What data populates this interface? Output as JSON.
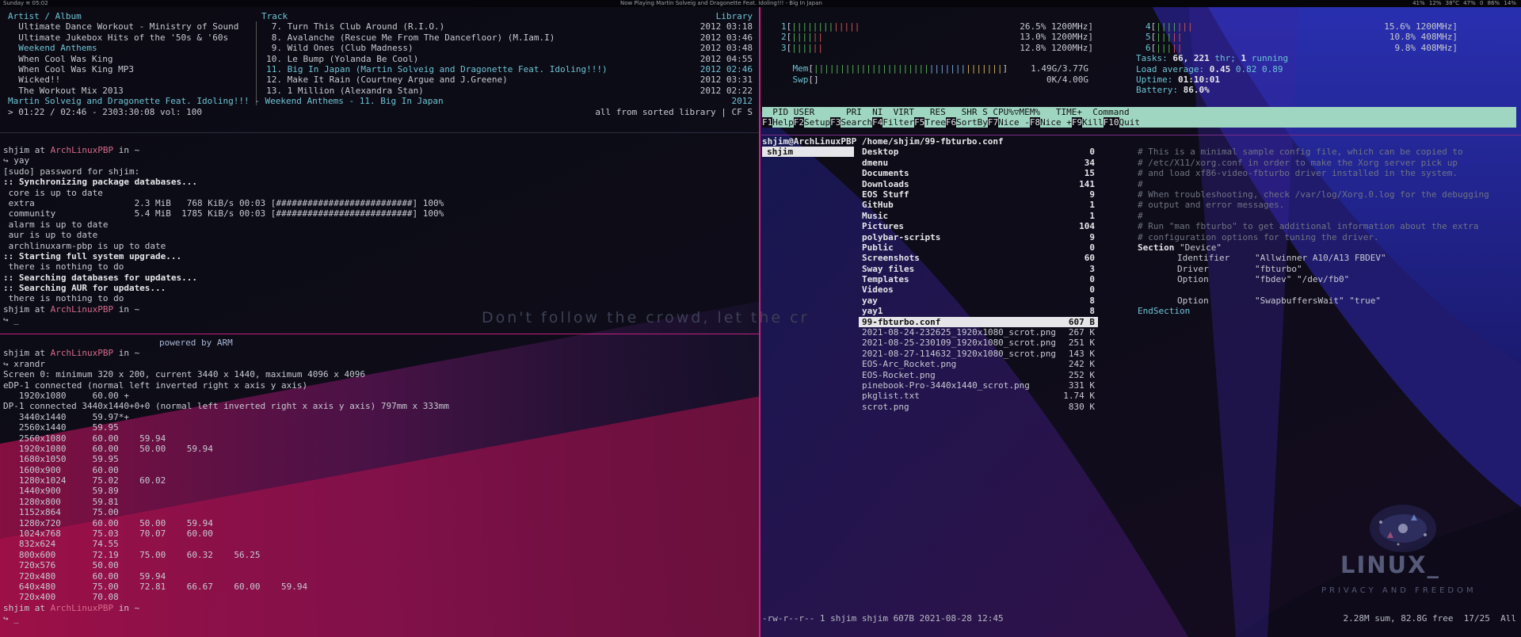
{
  "topbar": {
    "left": "Sunday ≋ 05:02",
    "now_playing_label": "Now Playing",
    "now_playing": "Martin Solveig and Dragonette Feat. Idoling!!! - Big In Japan",
    "status": "41%  12%  38°C  47%  0  86%  14%"
  },
  "cmus": {
    "header_left": "Artist / Album",
    "header_track": "Track",
    "header_right": "Library",
    "albums": [
      "Ultimate Dance Workout - Ministry of Sound",
      "Ultimate Jukebox Hits of the '50s & '60s",
      "Weekend Anthems",
      "When Cool Was King",
      "When Cool Was King MP3",
      "Wicked!!",
      "The Workout Mix 2013"
    ],
    "tracks": [
      {
        "num": "7.",
        "title": "Turn This Club Around (R.I.O.)",
        "year": "2012",
        "dur": "03:18"
      },
      {
        "num": "8.",
        "title": "Avalanche (Rescue Me From The Dancefloor) (M.Iam.I)",
        "year": "2012",
        "dur": "03:46"
      },
      {
        "num": "9.",
        "title": "Wild Ones (Club Madness)",
        "year": "2012",
        "dur": "03:48"
      },
      {
        "num": "10.",
        "title": "Le Bump (Yolanda Be Cool)",
        "year": "2012",
        "dur": "04:55"
      },
      {
        "num": "11.",
        "title": "Big In Japan (Martin Solveig and Dragonette Feat. Idoling!!!)",
        "year": "2012",
        "dur": "02:46"
      },
      {
        "num": "12.",
        "title": "Make It Rain (Courtney Argue and J.Greene)",
        "year": "2012",
        "dur": "03:31"
      },
      {
        "num": "13.",
        "title": "1 Million (Alexandra Stan)",
        "year": "2012",
        "dur": "02:22"
      }
    ],
    "now_line": "Martin Solveig and Dragonette Feat. Idoling!!! - Weekend Anthems - 11. Big In Japan",
    "now_year": "2012",
    "status_left": "> 01:22 / 02:46 - 2303:30:08 vol: 100",
    "status_right": "all from sorted library | CF S"
  },
  "term1": {
    "user": "shjim",
    "at": "at",
    "host": "ArchLinuxPBP",
    "in": "in",
    "dir": "~",
    "arrow": "↪",
    "cmd": "yay",
    "lines": [
      "[sudo] password for shjim:",
      ":: Synchronizing package databases...",
      " core is up to date",
      " extra                   2.3 MiB   768 KiB/s 00:03 [##########################] 100%",
      " community               5.4 MiB  1785 KiB/s 00:03 [##########################] 100%",
      " alarm is up to date",
      " aur is up to date",
      " archlinuxarm-pbp is up to date",
      ":: Starting full system upgrade...",
      " there is nothing to do",
      ":: Searching databases for updates...",
      ":: Searching AUR for updates...",
      " there is nothing to do"
    ],
    "cursor": "_"
  },
  "wallpaper_motto": "Don't follow the crowd, let the cr",
  "term2": {
    "powered": "powered by ARM",
    "cmd": "xrandr",
    "lines": [
      "Screen 0: minimum 320 x 200, current 3440 x 1440, maximum 4096 x 4096",
      "eDP-1 connected (normal left inverted right x axis y axis)",
      "   1920x1080     60.00 +",
      "DP-1 connected 3440x1440+0+0 (normal left inverted right x axis y axis) 797mm x 333mm",
      "   3440x1440     59.97*+",
      "   2560x1440     59.95",
      "   2560x1080     60.00    59.94",
      "   1920x1080     60.00    50.00    59.94",
      "   1680x1050     59.95",
      "   1600x900      60.00",
      "   1280x1024     75.02    60.02",
      "   1440x900      59.89",
      "   1280x800      59.81",
      "   1152x864      75.00",
      "   1280x720      60.00    50.00    59.94",
      "   1024x768      75.03    70.07    60.00",
      "   832x624       74.55",
      "   800x600       72.19    75.00    60.32    56.25",
      "   720x576       50.00",
      "   720x480       60.00    59.94",
      "   640x480       75.00    72.81    66.67    60.00    59.94",
      "   720x400       70.08"
    ]
  },
  "htop": {
    "cpus": [
      {
        "n": "1",
        "pct": "26.5%",
        "freq": "1200MHz",
        "load": 0.265
      },
      {
        "n": "2",
        "pct": "13.0%",
        "freq": "1200MHz",
        "load": 0.13
      },
      {
        "n": "3",
        "pct": "12.8%",
        "freq": "1200MHz",
        "load": 0.128
      },
      {
        "n": "4",
        "pct": "15.6%",
        "freq": "1200MHz",
        "load": 0.156
      },
      {
        "n": "5",
        "pct": "10.8%",
        "freq": "408MHz",
        "load": 0.108
      },
      {
        "n": "6",
        "pct": "9.8%",
        "freq": "408MHz",
        "load": 0.098
      }
    ],
    "mem_label": "Mem",
    "mem_val": "1.49G/3.77G",
    "mem_load": 0.395,
    "swp_label": "Swp",
    "swp_val": "0K/4.00G",
    "tasks_label": "Tasks:",
    "tasks_val": "66,",
    "thr_val": "221",
    "thr_label": "thr;",
    "running_val": "1",
    "running_label": "running",
    "load_label": "Load average:",
    "load1": "0.45",
    "load5": "0.82",
    "load15": "0.89",
    "uptime_label": "Uptime:",
    "uptime_val": "01:10:01",
    "battery_label": "Battery:",
    "battery_val": "86.0%",
    "header": "  PID USER      PRI  NI  VIRT   RES   SHR S CPU%▽MEM%   TIME+  Command",
    "fkeys": [
      {
        "k": "F1",
        "v": "Help"
      },
      {
        "k": "F2",
        "v": "Setup"
      },
      {
        "k": "F3",
        "v": "Search"
      },
      {
        "k": "F4",
        "v": "Filter"
      },
      {
        "k": "F5",
        "v": "Tree"
      },
      {
        "k": "F6",
        "v": "SortBy"
      },
      {
        "k": "F7",
        "v": "Nice -"
      },
      {
        "k": "F8",
        "v": "Nice +"
      },
      {
        "k": "F9",
        "v": "Kill"
      },
      {
        "k": "F10",
        "v": "Quit"
      }
    ]
  },
  "ranger": {
    "title_user": "shjim@ArchLinuxPBP",
    "title_path": "/home/shjim/99-fbturbo.conf",
    "parent_item": "shjim",
    "entries": [
      {
        "name": "Desktop",
        "size": "0",
        "dir": true
      },
      {
        "name": "dmenu",
        "size": "34",
        "dir": true
      },
      {
        "name": "Documents",
        "size": "15",
        "dir": true
      },
      {
        "name": "Downloads",
        "size": "141",
        "dir": true
      },
      {
        "name": "EOS Stuff",
        "size": "9",
        "dir": true
      },
      {
        "name": "GitHub",
        "size": "1",
        "dir": true
      },
      {
        "name": "Music",
        "size": "1",
        "dir": true
      },
      {
        "name": "Pictures",
        "size": "104",
        "dir": true
      },
      {
        "name": "polybar-scripts",
        "size": "9",
        "dir": true
      },
      {
        "name": "Public",
        "size": "0",
        "dir": true
      },
      {
        "name": "Screenshots",
        "size": "60",
        "dir": true
      },
      {
        "name": "Sway files",
        "size": "3",
        "dir": true
      },
      {
        "name": "Templates",
        "size": "0",
        "dir": true
      },
      {
        "name": "Videos",
        "size": "0",
        "dir": true
      },
      {
        "name": "yay",
        "size": "8",
        "dir": true
      },
      {
        "name": "yay1",
        "size": "8",
        "dir": true
      },
      {
        "name": "99-fbturbo.conf",
        "size": "607 B",
        "dir": false,
        "selected": true
      },
      {
        "name": "2021-08-24-232625_1920x1080_scrot.png",
        "size": "267 K",
        "dir": false
      },
      {
        "name": "2021-08-25-230109_1920x1080_scrot.png",
        "size": "251 K",
        "dir": false
      },
      {
        "name": "2021-08-27-114632_1920x1080_scrot.png",
        "size": "143 K",
        "dir": false
      },
      {
        "name": "EOS-Arc_Rocket.png",
        "size": "242 K",
        "dir": false
      },
      {
        "name": "EOS-Rocket.png",
        "size": "252 K",
        "dir": false
      },
      {
        "name": "pinebook-Pro-3440x1440_scrot.png",
        "size": "331 K",
        "dir": false
      },
      {
        "name": "pkglist.txt",
        "size": "1.74 K",
        "dir": false
      },
      {
        "name": "scrot.png",
        "size": "830 K",
        "dir": false
      }
    ],
    "preview_comments": [
      "# This is a minimal sample config file, which can be copied to",
      "# /etc/X11/xorg.conf in order to make the Xorg server pick up",
      "# and load xf86-video-fbturbo driver installed in the system.",
      "#",
      "# When troubleshooting, check /var/log/Xorg.0.log for the debugging",
      "# output and error messages.",
      "#",
      "# Run \"man fbturbo\" to get additional information about the extra",
      "# configuration options for tuning the driver."
    ],
    "section_kw": "Section",
    "section_val": "\"Device\"",
    "options": [
      {
        "k": "Identifier",
        "v": "\"Allwinner A10/A13 FBDEV\""
      },
      {
        "k": "Driver",
        "v": "\"fbturbo\""
      },
      {
        "k": "Option",
        "v": "\"fbdev\" \"/dev/fb0\""
      },
      {
        "k": "",
        "v": ""
      },
      {
        "k": "Option",
        "v": "\"SwapbuffersWait\" \"true\""
      }
    ],
    "end_section": "EndSection",
    "status_left": "-rw-r--r-- 1 shjim shjim 607B 2021-08-28 12:45",
    "status_right": "2.28M sum, 82.8G free  17/25  All"
  },
  "logo": {
    "title": "LINUX_",
    "subtitle": "PRIVACY AND FREEDOM"
  },
  "colors": {
    "accent_pink": "#d21f86",
    "cyan": "#6ec3d4",
    "htop_header_bg": "#9fd6c2"
  }
}
